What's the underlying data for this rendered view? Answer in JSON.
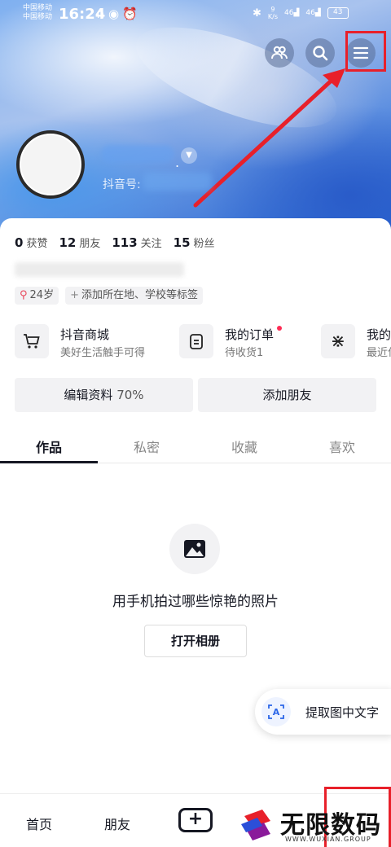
{
  "status_bar": {
    "carrier1": "中国移动",
    "carrier2": "中国移动",
    "time": "16:24",
    "left_icons": "∩◉⏰",
    "speed_value": "9",
    "speed_unit": "K/s",
    "signal1": "46",
    "signal2": "46",
    "battery": "43"
  },
  "header": {
    "friends_icon": "friends-icon",
    "search_icon": "search-icon",
    "menu_icon": "menu-icon",
    "douyin_id_label": "抖音号:"
  },
  "stats": [
    {
      "num": "0",
      "label": "获赞"
    },
    {
      "num": "12",
      "label": "朋友"
    },
    {
      "num": "113",
      "label": "关注"
    },
    {
      "num": "15",
      "label": "粉丝"
    }
  ],
  "tags": {
    "age": "24岁",
    "add_tags": "添加所在地、学校等标签"
  },
  "shortcuts": [
    {
      "title": "抖音商城",
      "subtitle": "美好生活触手可得"
    },
    {
      "title": "我的订单",
      "subtitle": "待收货1"
    },
    {
      "title": "我的",
      "subtitle": "最近位"
    }
  ],
  "actions": {
    "edit_profile": "编辑资料",
    "edit_percent": "70%",
    "add_friend": "添加朋友"
  },
  "tabs": [
    "作品",
    "私密",
    "收藏",
    "喜欢"
  ],
  "empty": {
    "message": "用手机拍过哪些惊艳的照片",
    "album_button": "打开相册"
  },
  "ocr": {
    "label": "提取图中文字"
  },
  "bottom_nav": {
    "home": "首页",
    "friends": "朋友",
    "plus": "+"
  },
  "watermark": {
    "title": "无限数码",
    "subtitle": "WWW.WUXIAN.GROUP"
  },
  "colors": {
    "annotation_red": "#e8202a",
    "accent_pink": "#fe2c55",
    "text_dark": "#161823"
  }
}
